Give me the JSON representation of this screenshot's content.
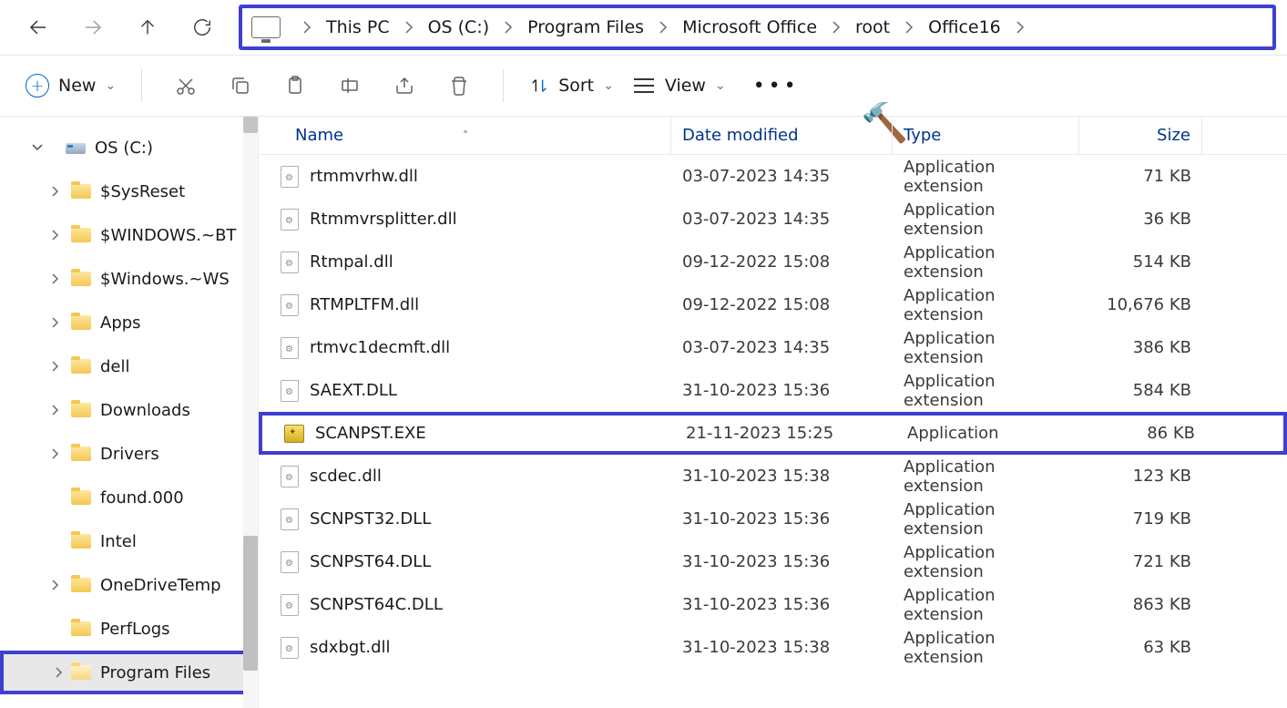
{
  "breadcrumb": {
    "items": [
      "This PC",
      "OS (C:)",
      "Program Files",
      "Microsoft Office",
      "root",
      "Office16"
    ]
  },
  "toolbar": {
    "new_label": "New",
    "sort_label": "Sort",
    "view_label": "View"
  },
  "sidebar": {
    "root": "OS (C:)",
    "items": [
      {
        "label": "$SysReset",
        "expandable": true
      },
      {
        "label": "$WINDOWS.~BT",
        "expandable": true
      },
      {
        "label": "$Windows.~WS",
        "expandable": true
      },
      {
        "label": "Apps",
        "expandable": true
      },
      {
        "label": "dell",
        "expandable": true
      },
      {
        "label": "Downloads",
        "expandable": true
      },
      {
        "label": "Drivers",
        "expandable": true
      },
      {
        "label": "found.000",
        "expandable": false
      },
      {
        "label": "Intel",
        "expandable": false
      },
      {
        "label": "OneDriveTemp",
        "expandable": true
      },
      {
        "label": "PerfLogs",
        "expandable": false
      },
      {
        "label": "Program Files",
        "expandable": true,
        "highlighted": true
      }
    ]
  },
  "columns": {
    "name": "Name",
    "date": "Date modified",
    "type": "Type",
    "size": "Size"
  },
  "files": [
    {
      "name": "rtmmvrhw.dll",
      "date": "03-07-2023 14:35",
      "type": "Application extension",
      "size": "71 KB",
      "icon": "dll"
    },
    {
      "name": "Rtmmvrsplitter.dll",
      "date": "03-07-2023 14:35",
      "type": "Application extension",
      "size": "36 KB",
      "icon": "dll"
    },
    {
      "name": "Rtmpal.dll",
      "date": "09-12-2022 15:08",
      "type": "Application extension",
      "size": "514 KB",
      "icon": "dll"
    },
    {
      "name": "RTMPLTFM.dll",
      "date": "09-12-2022 15:08",
      "type": "Application extension",
      "size": "10,676 KB",
      "icon": "dll"
    },
    {
      "name": "rtmvc1decmft.dll",
      "date": "03-07-2023 14:35",
      "type": "Application extension",
      "size": "386 KB",
      "icon": "dll"
    },
    {
      "name": "SAEXT.DLL",
      "date": "31-10-2023 15:36",
      "type": "Application extension",
      "size": "584 KB",
      "icon": "dll"
    },
    {
      "name": "SCANPST.EXE",
      "date": "21-11-2023 15:25",
      "type": "Application",
      "size": "86 KB",
      "icon": "exe",
      "highlighted": true
    },
    {
      "name": "scdec.dll",
      "date": "31-10-2023 15:38",
      "type": "Application extension",
      "size": "123 KB",
      "icon": "dll"
    },
    {
      "name": "SCNPST32.DLL",
      "date": "31-10-2023 15:36",
      "type": "Application extension",
      "size": "719 KB",
      "icon": "dll"
    },
    {
      "name": "SCNPST64.DLL",
      "date": "31-10-2023 15:36",
      "type": "Application extension",
      "size": "721 KB",
      "icon": "dll"
    },
    {
      "name": "SCNPST64C.DLL",
      "date": "31-10-2023 15:36",
      "type": "Application extension",
      "size": "863 KB",
      "icon": "dll"
    },
    {
      "name": "sdxbgt.dll",
      "date": "31-10-2023 15:38",
      "type": "Application extension",
      "size": "63 KB",
      "icon": "dll"
    }
  ]
}
